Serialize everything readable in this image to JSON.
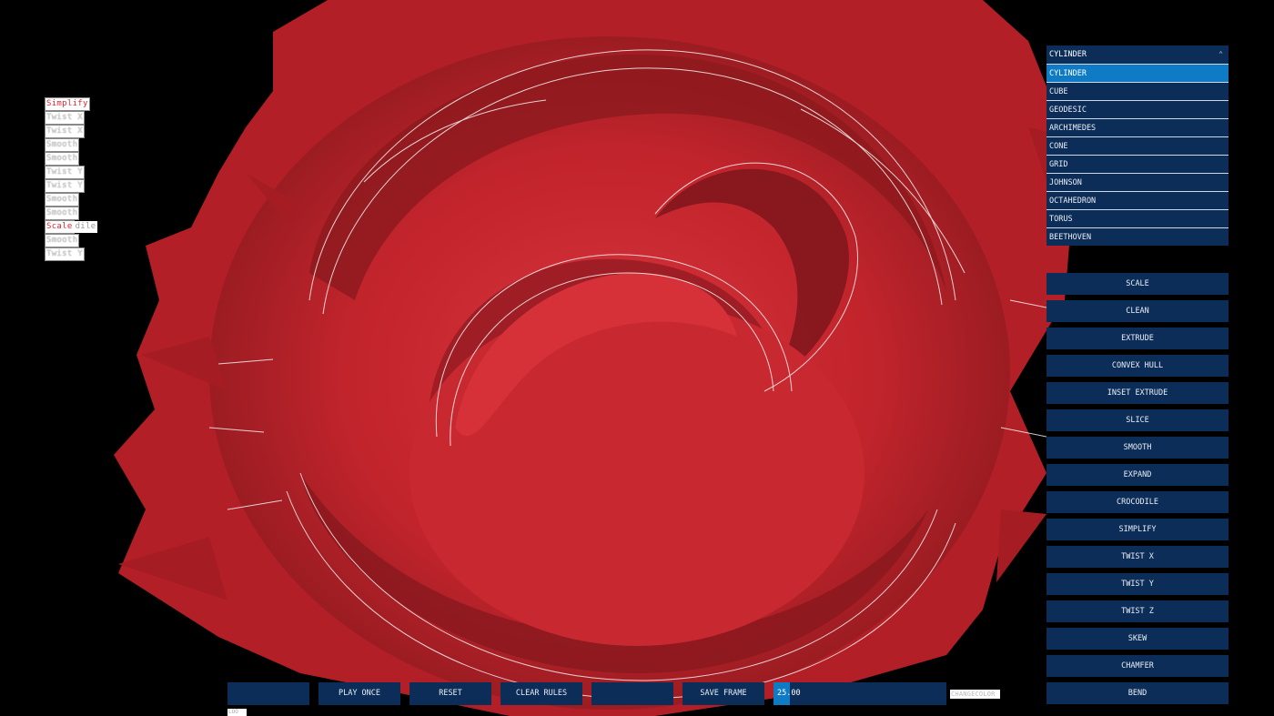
{
  "viewport": {
    "object_color": "#c4262e",
    "edge_color": "#ffffff"
  },
  "rules": [
    {
      "label": "Simplify",
      "active": true
    },
    {
      "label": "Twist X",
      "active": false
    },
    {
      "label": "Twist X",
      "active": false
    },
    {
      "label": "Smooth",
      "active": false
    },
    {
      "label": "Smooth",
      "active": false
    },
    {
      "label": "Twist Y",
      "active": false
    },
    {
      "label": "Twist Y",
      "active": false
    },
    {
      "label": "Smooth",
      "active": false
    },
    {
      "label": "Smooth",
      "active": false
    },
    {
      "label": "Scale",
      "suffix": "dile",
      "active": true
    },
    {
      "label": "Smooth",
      "active": false
    },
    {
      "label": "Twist Y",
      "active": false
    }
  ],
  "shape_dropdown": {
    "selected": "CYLINDER",
    "options": [
      "CYLINDER",
      "CUBE",
      "GEODESIC",
      "ARCHIMEDES",
      "CONE",
      "GRID",
      "JOHNSON",
      "OCTAHEDRON",
      "TORUS",
      "BEETHOVEN"
    ]
  },
  "operations": [
    "SCALE",
    "CLEAN",
    "EXTRUDE",
    "CONVEX HULL",
    "INSET EXTRUDE",
    "SLICE",
    "SMOOTH",
    "EXPAND",
    "CROCODILE",
    "SIMPLIFY",
    "TWIST X",
    "TWIST Y",
    "TWIST Z",
    "SKEW",
    "CHAMFER",
    "BEND"
  ],
  "bottom_bar": {
    "button_1": "",
    "play_once": "PLAY ONCE",
    "reset": "RESET",
    "clear_rules": "CLEAR RULES",
    "button_5": "",
    "save_frame": "SAVE FRAME",
    "speed_value": "25.00",
    "speed_fraction": 0.095,
    "change_color": "CHANGECOLOR",
    "tiny_label": "LOO"
  },
  "colors": {
    "panel": "#0c2d57",
    "accent": "#0e7bc4",
    "active_rule": "#e0242f"
  }
}
